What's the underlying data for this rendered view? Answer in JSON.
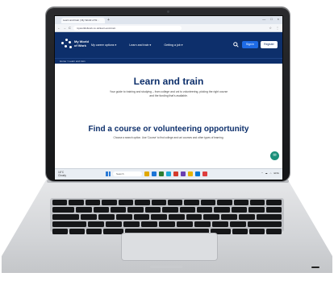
{
  "browser": {
    "tab_title": "Learn and train | My World of W...",
    "tab_plus": "+",
    "url": "myworldofwork.co.uk/learn-and-train",
    "window_controls": [
      "—",
      "□",
      "×"
    ],
    "nav_icons": [
      "←",
      "→",
      "C"
    ],
    "addr_right_icons": [
      "☆",
      "⋮"
    ]
  },
  "site": {
    "logo_text": "My World of Work",
    "menu": [
      "My career options ▾",
      "Learn and train ▾",
      "Getting a job ▾"
    ],
    "search_icon": "search-icon",
    "signin_label": "Sign in",
    "register_label": "Register",
    "breadcrumb": "Home > Learn and train"
  },
  "hero": {
    "title": "Learn and train",
    "subtitle": "Your guide to training and studying – from college and uni to volunteering, picking the right course and the funding that's available."
  },
  "find": {
    "title": "Find a course or volunteering opportunity",
    "subtitle": "Choose a search option. Use 'Course' to find college and uni courses and other types of learning."
  },
  "chat": {
    "label": "✉"
  },
  "taskbar": {
    "weather": "16°C\nCloudy",
    "search_placeholder": "Search",
    "app_colors": [
      "#e0a800",
      "#1b74d6",
      "#2d7d32",
      "#1faad8",
      "#d33b2c",
      "#6a3fb0",
      "#e6b400",
      "#0078d4",
      "#de3e3e"
    ],
    "tray": [
      "^",
      "☁",
      "⌂",
      "ENG"
    ]
  }
}
